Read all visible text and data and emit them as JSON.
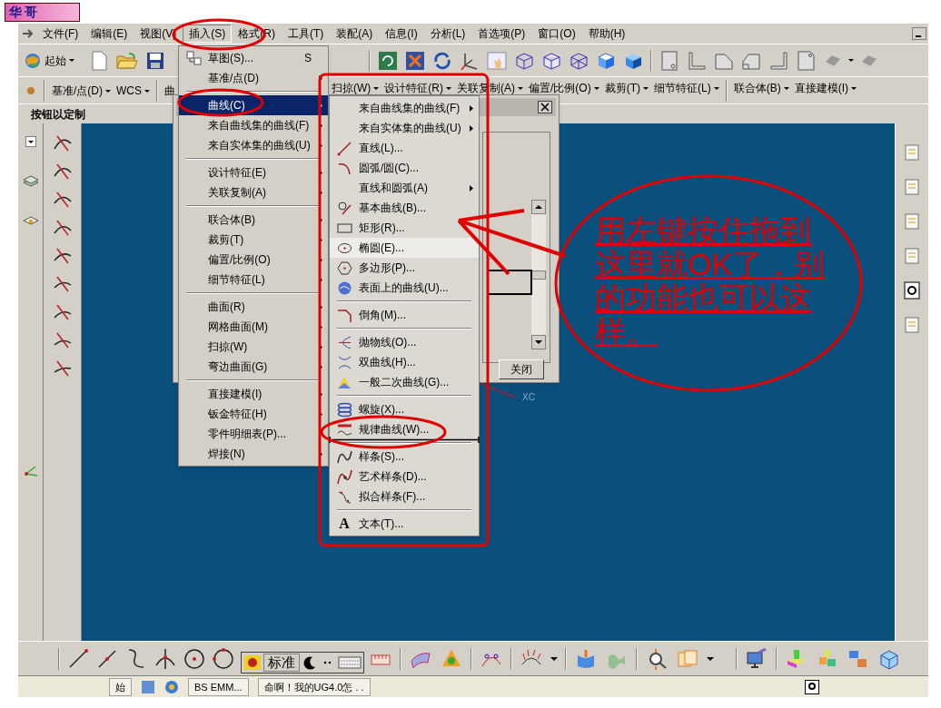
{
  "badge": {
    "label": "华哥"
  },
  "menubar": {
    "items": [
      {
        "label": "文件(F)",
        "selected": false
      },
      {
        "label": "编辑(E)",
        "selected": false
      },
      {
        "label": "视图(V)",
        "selected": false
      },
      {
        "label": "插入(S)",
        "selected": true
      },
      {
        "label": "格式(R)",
        "selected": false
      },
      {
        "label": "工具(T)",
        "selected": false
      },
      {
        "label": "装配(A)",
        "selected": false
      },
      {
        "label": "信息(I)",
        "selected": false
      },
      {
        "label": "分析(L)",
        "selected": false
      },
      {
        "label": "首选项(P)",
        "selected": false
      },
      {
        "label": "窗口(O)",
        "selected": false
      },
      {
        "label": "帮助(H)",
        "selected": false
      }
    ]
  },
  "standard_toolbar": {
    "start_button": "起始"
  },
  "feature_toolbar": {
    "left_groups": [
      [
        {
          "label": "基准/点(D)",
          "dropdown": true
        },
        {
          "label": "WCS",
          "dropdown": true
        }
      ],
      [
        {
          "label": "曲",
          "dropdown": false
        }
      ]
    ],
    "right_groups": [
      [
        {
          "label": "扫掠(W)",
          "dropdown": true
        },
        {
          "label": "设计特征(R)",
          "dropdown": true
        },
        {
          "label": "关联复制(A)",
          "dropdown": true
        },
        {
          "label": "偏置/比例(O)",
          "dropdown": true
        },
        {
          "label": "裁剪(T)",
          "dropdown": true
        },
        {
          "label": "细节特征(L)",
          "dropdown": true
        }
      ],
      [
        {
          "label": "联合体(B)",
          "dropdown": true
        },
        {
          "label": "直接建模(I)",
          "dropdown": true
        }
      ]
    ]
  },
  "customize_hint": "按钮以定制",
  "insert_menu": {
    "groups": [
      [
        {
          "label": "草图(S)...",
          "shortcut": "S",
          "submenu": false,
          "selected": false
        },
        {
          "label": "基准/点(D)",
          "submenu": true,
          "selected": false
        }
      ],
      [
        {
          "label": "曲线(C)",
          "submenu": true,
          "selected": true
        },
        {
          "label": "来自曲线集的曲线(F)",
          "submenu": true,
          "selected": false
        },
        {
          "label": "来自实体集的曲线(U)",
          "submenu": true,
          "selected": false
        }
      ],
      [
        {
          "label": "设计特征(E)",
          "submenu": true,
          "selected": false
        },
        {
          "label": "关联复制(A)",
          "submenu": true,
          "selected": false
        }
      ],
      [
        {
          "label": "联合体(B)",
          "submenu": true,
          "selected": false
        },
        {
          "label": "裁剪(T)",
          "submenu": true,
          "selected": false
        },
        {
          "label": "偏置/比例(O)",
          "submenu": true,
          "selected": false
        },
        {
          "label": "细节特征(L)",
          "submenu": true,
          "selected": false
        }
      ],
      [
        {
          "label": "曲面(R)",
          "submenu": true,
          "selected": false
        },
        {
          "label": "网格曲面(M)",
          "submenu": true,
          "selected": false
        },
        {
          "label": "扫掠(W)",
          "submenu": true,
          "selected": false
        },
        {
          "label": "弯边曲面(G)",
          "submenu": true,
          "selected": false
        }
      ],
      [
        {
          "label": "直接建模(I)",
          "submenu": true,
          "selected": false
        },
        {
          "label": "钣金特征(H)",
          "submenu": true,
          "selected": false
        },
        {
          "label": "零件明细表(P)...",
          "submenu": false,
          "selected": false
        },
        {
          "label": "焊接(N)",
          "submenu": true,
          "selected": false
        }
      ]
    ]
  },
  "curve_submenu": {
    "groups": [
      [
        {
          "label": "来自曲线集的曲线(F)",
          "submenu": true,
          "selected": false
        },
        {
          "label": "来自实体集的曲线(U)",
          "submenu": true,
          "selected": false
        },
        {
          "label": "直线(L)...",
          "submenu": false,
          "selected": false
        },
        {
          "label": "圆弧/圆(C)...",
          "submenu": false,
          "selected": false
        },
        {
          "label": "直线和圆弧(A)",
          "submenu": true,
          "selected": false
        },
        {
          "label": "基本曲线(B)...",
          "submenu": false,
          "selected": false
        },
        {
          "label": "矩形(R)...",
          "submenu": false,
          "selected": false
        },
        {
          "label": "椭圆(E)...",
          "submenu": false,
          "selected": true
        },
        {
          "label": "多边形(P)...",
          "submenu": false,
          "selected": false
        },
        {
          "label": "表面上的曲线(U)...",
          "submenu": false,
          "selected": false
        }
      ],
      [
        {
          "label": "倒角(M)...",
          "submenu": false,
          "selected": false
        }
      ],
      [
        {
          "label": "抛物线(O)...",
          "submenu": false,
          "selected": false
        },
        {
          "label": "双曲线(H)...",
          "submenu": false,
          "selected": false
        },
        {
          "label": "一般二次曲线(G)...",
          "submenu": false,
          "selected": false
        }
      ],
      [
        {
          "label": "螺旋(X)...",
          "submenu": false,
          "selected": false
        },
        {
          "label": "规律曲线(W)...",
          "submenu": false,
          "selected": false
        }
      ],
      [
        {
          "label": "样条(S)...",
          "submenu": false,
          "selected": false
        },
        {
          "label": "艺术样条(D)...",
          "submenu": false,
          "selected": false
        },
        {
          "label": "拟合样条(F)...",
          "submenu": false,
          "selected": false
        }
      ],
      [
        {
          "label": "文本(T)...",
          "icon_glyph": "A",
          "submenu": false,
          "selected": false
        }
      ]
    ]
  },
  "dialog": {
    "close_button": "关闭"
  },
  "canvas": {
    "axis_label": "XC"
  },
  "annotation": {
    "text": "用左键按住拖到这里就OK了，别的功能也可以这样。"
  },
  "ime_bar": {
    "mode": "标准"
  },
  "taskbar": {
    "items": [
      "始",
      "BS EMM...",
      "命啊！我的UG4.0怎 . ."
    ]
  }
}
